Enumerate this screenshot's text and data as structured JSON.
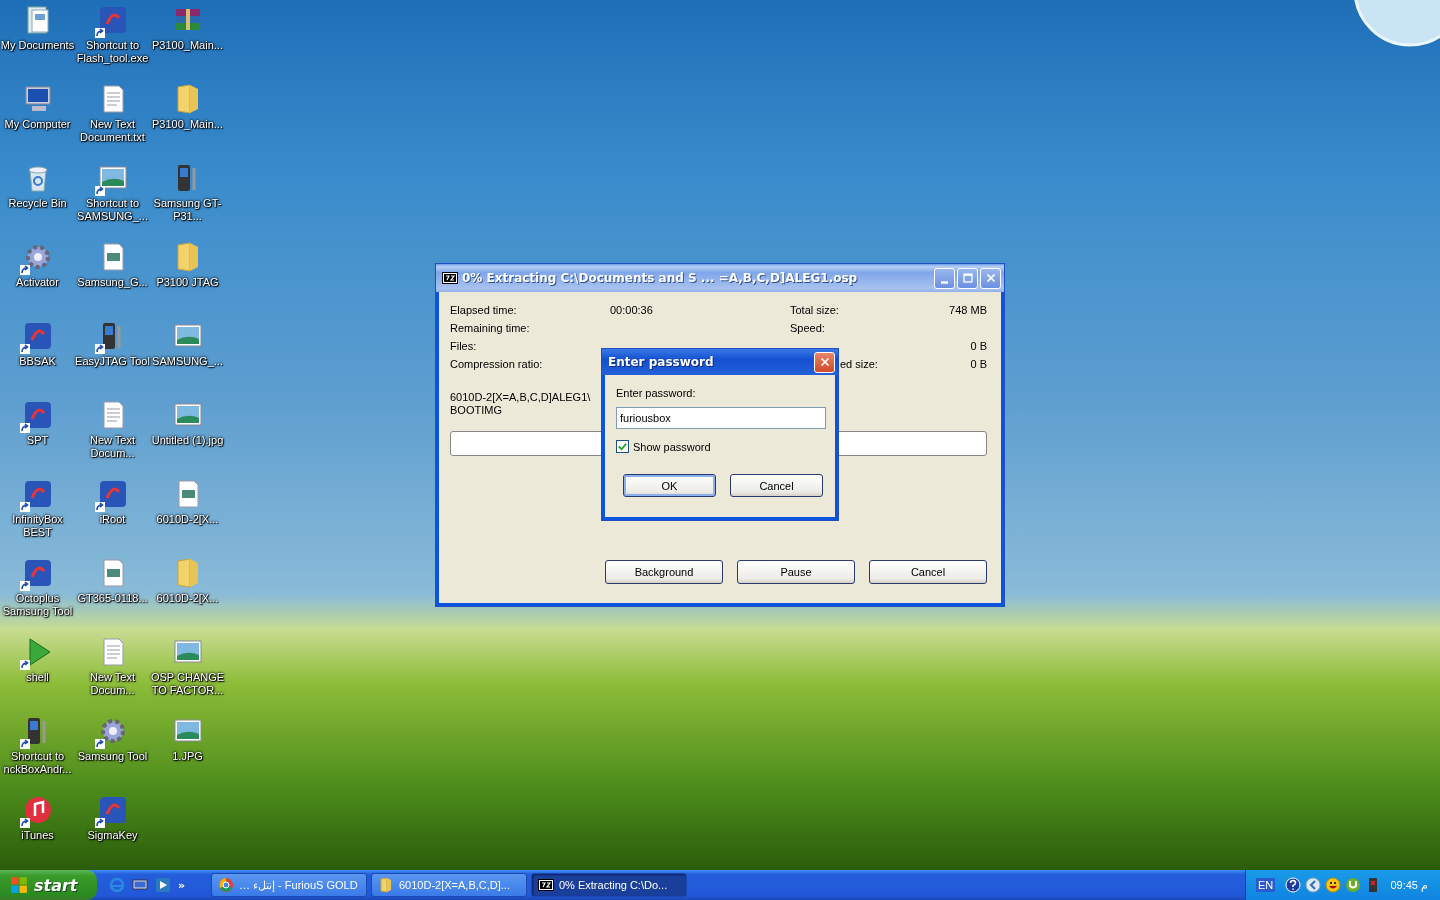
{
  "desktop_icons": [
    {
      "label": "My Documents",
      "kind": "documents",
      "shortcut": false
    },
    {
      "label": "Shortcut to Flash_tool.exe",
      "kind": "app",
      "shortcut": true
    },
    {
      "label": "P3100_Main...",
      "kind": "archive",
      "shortcut": false
    },
    {
      "label": "My Computer",
      "kind": "computer",
      "shortcut": false
    },
    {
      "label": "New Text Document.txt",
      "kind": "text",
      "shortcut": false
    },
    {
      "label": "P3100_Main...",
      "kind": "folder",
      "shortcut": false
    },
    {
      "label": "Recycle Bin",
      "kind": "recycle",
      "shortcut": false
    },
    {
      "label": "Shortcut to SAMSUNG_...",
      "kind": "image",
      "shortcut": true
    },
    {
      "label": "Samsung GT-P31...",
      "kind": "phone",
      "shortcut": false
    },
    {
      "label": "Activator",
      "kind": "gear",
      "shortcut": true
    },
    {
      "label": "Samsung_G...",
      "kind": "file",
      "shortcut": false
    },
    {
      "label": "P3100 JTAG",
      "kind": "folder",
      "shortcut": false
    },
    {
      "label": "BBSAK",
      "kind": "app",
      "shortcut": true
    },
    {
      "label": "EasyJTAG Tool",
      "kind": "phone",
      "shortcut": true
    },
    {
      "label": "SAMSUNG_...",
      "kind": "image",
      "shortcut": false
    },
    {
      "label": "SPT",
      "kind": "app",
      "shortcut": true
    },
    {
      "label": "New Text Docum...",
      "kind": "text",
      "shortcut": false
    },
    {
      "label": "Untitled (1).jpg",
      "kind": "image",
      "shortcut": false
    },
    {
      "label": "InfinityBox BEST",
      "kind": "app",
      "shortcut": true
    },
    {
      "label": "iRoot",
      "kind": "app",
      "shortcut": true
    },
    {
      "label": "6010D-2[X...",
      "kind": "file",
      "shortcut": false
    },
    {
      "label": "Octoplus Samsung Tool",
      "kind": "app",
      "shortcut": true
    },
    {
      "label": "GT365-0118...",
      "kind": "file",
      "shortcut": false
    },
    {
      "label": "6010D-2[X...",
      "kind": "folder",
      "shortcut": false
    },
    {
      "label": "shell",
      "kind": "play",
      "shortcut": true
    },
    {
      "label": "New Text Docum...",
      "kind": "text",
      "shortcut": false
    },
    {
      "label": "OSP CHANGE TO FACTOR...",
      "kind": "image",
      "shortcut": false
    },
    {
      "label": "Shortcut to nckBoxAndr...",
      "kind": "phone",
      "shortcut": true
    },
    {
      "label": "Samsung Tool",
      "kind": "gear",
      "shortcut": true
    },
    {
      "label": "1.JPG",
      "kind": "image",
      "shortcut": false
    },
    {
      "label": "iTunes",
      "kind": "music",
      "shortcut": true
    },
    {
      "label": "SigmaKey",
      "kind": "app",
      "shortcut": true
    }
  ],
  "window": {
    "title": "0% Extracting C:\\Documents and S ... =A,B,C,D]ALEG1.osp",
    "left_stats": [
      {
        "label": "Elapsed time:",
        "value": "00:00:36"
      },
      {
        "label": "Remaining time:"
      },
      {
        "label": "Files:"
      },
      {
        "label": "Compression ratio:"
      }
    ],
    "right_stats": [
      {
        "label": "Total size:",
        "value": "748 MB",
        "kind": "full"
      },
      {
        "label": "Speed:",
        "kind": "full"
      },
      {
        "value": "0 B",
        "kind": "full"
      },
      {
        "label": "ed size:",
        "value": "0 B",
        "kind": "partial"
      }
    ],
    "current_file": [
      "6010D-2[X=A,B,C,D]ALEG1\\",
      "BOOTIMG"
    ],
    "progress": {
      "level": 0
    },
    "buttons": [
      "Background",
      "Pause",
      "Cancel"
    ]
  },
  "dialog": {
    "title": "Enter password",
    "prompt": "Enter password:",
    "password": "furiousbox",
    "show_password": {
      "label": "Show password",
      "checked": true
    },
    "buttons": [
      "OK",
      "Cancel"
    ]
  },
  "taskbar": {
    "start": "start",
    "more": "»",
    "tasks": [
      {
        "label": "… إنتلء - FuriouS GOLD",
        "kind": "browser",
        "selected": false
      },
      {
        "label": "6010D-2[X=A,B,C,D]...",
        "kind": "folder",
        "selected": false
      },
      {
        "label": "0% Extracting C:\\Do...",
        "kind": "archiver",
        "selected": true
      }
    ],
    "language": "EN",
    "clock": "09:45 م"
  }
}
